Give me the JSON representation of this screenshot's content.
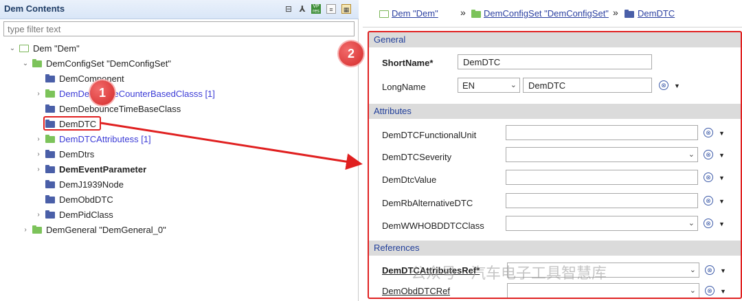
{
  "left": {
    "title": "Dem Contents",
    "filter_placeholder": "type filter text",
    "toolbar_icons": [
      "collapse-all-icon",
      "link-icon",
      "vp-res-icon",
      "document-icon",
      "table-icon"
    ],
    "tree": [
      {
        "label": "Dem \"Dem\"",
        "icon": "module",
        "chev": "v"
      },
      {
        "label": "DemConfigSet \"DemConfigSet\"",
        "icon": "green",
        "chev": "v"
      },
      {
        "label": "DemComponent",
        "icon": "blue",
        "chev": ""
      },
      {
        "label": "DemDebounceCounterBasedClasss [1]",
        "icon": "green",
        "chev": ">",
        "style": "link"
      },
      {
        "label": "DemDebounceTimeBaseClass",
        "icon": "blue",
        "chev": ""
      },
      {
        "label": "DemDTC",
        "icon": "blue",
        "chev": "",
        "selected": true
      },
      {
        "label": "DemDTCAttributess [1]",
        "icon": "green",
        "chev": ">",
        "style": "link"
      },
      {
        "label": "DemDtrs",
        "icon": "blue",
        "chev": ">"
      },
      {
        "label": "DemEventParameter",
        "icon": "blue",
        "chev": ">",
        "style": "bold"
      },
      {
        "label": "DemJ1939Node",
        "icon": "blue",
        "chev": ""
      },
      {
        "label": "DemObdDTC",
        "icon": "blue",
        "chev": ""
      },
      {
        "label": "DemPidClass",
        "icon": "blue",
        "chev": ">"
      },
      {
        "label": "DemGeneral \"DemGeneral_0\"",
        "icon": "green",
        "chev": ">"
      }
    ]
  },
  "breadcrumb": [
    {
      "label": "Dem \"Dem\""
    },
    {
      "label": "DemConfigSet \"DemConfigSet\""
    },
    {
      "label": "DemDTC"
    }
  ],
  "breadcrumb_sep": "»",
  "sections": {
    "general": "General",
    "attributes": "Attributes",
    "references": "References"
  },
  "general": {
    "shortname_label": "ShortName*",
    "shortname_value": "DemDTC",
    "longname_label": "LongName",
    "lang_value": "EN",
    "longname_value": "DemDTC"
  },
  "attributes": [
    {
      "label": "DemDTCFunctionalUnit",
      "kind": "text",
      "value": ""
    },
    {
      "label": "DemDTCSeverity",
      "kind": "combo",
      "value": ""
    },
    {
      "label": "DemDtcValue",
      "kind": "text",
      "value": ""
    },
    {
      "label": "DemRbAlternativeDTC",
      "kind": "text",
      "value": ""
    },
    {
      "label": "DemWWHOBDDTCClass",
      "kind": "combo",
      "value": ""
    }
  ],
  "references": [
    {
      "label": "DemDTCAttributesRef*",
      "style": "bold-underline"
    },
    {
      "label": "DemObdDTCRef",
      "style": "underline"
    }
  ],
  "annotations": {
    "badge1": "1",
    "badge2": "2"
  },
  "watermark": "公众号 · 汽车电子工具智慧库",
  "colors": {
    "annotation_red": "#e02020",
    "section_text": "#1f3d99",
    "link_blue": "#3b3bd6"
  }
}
